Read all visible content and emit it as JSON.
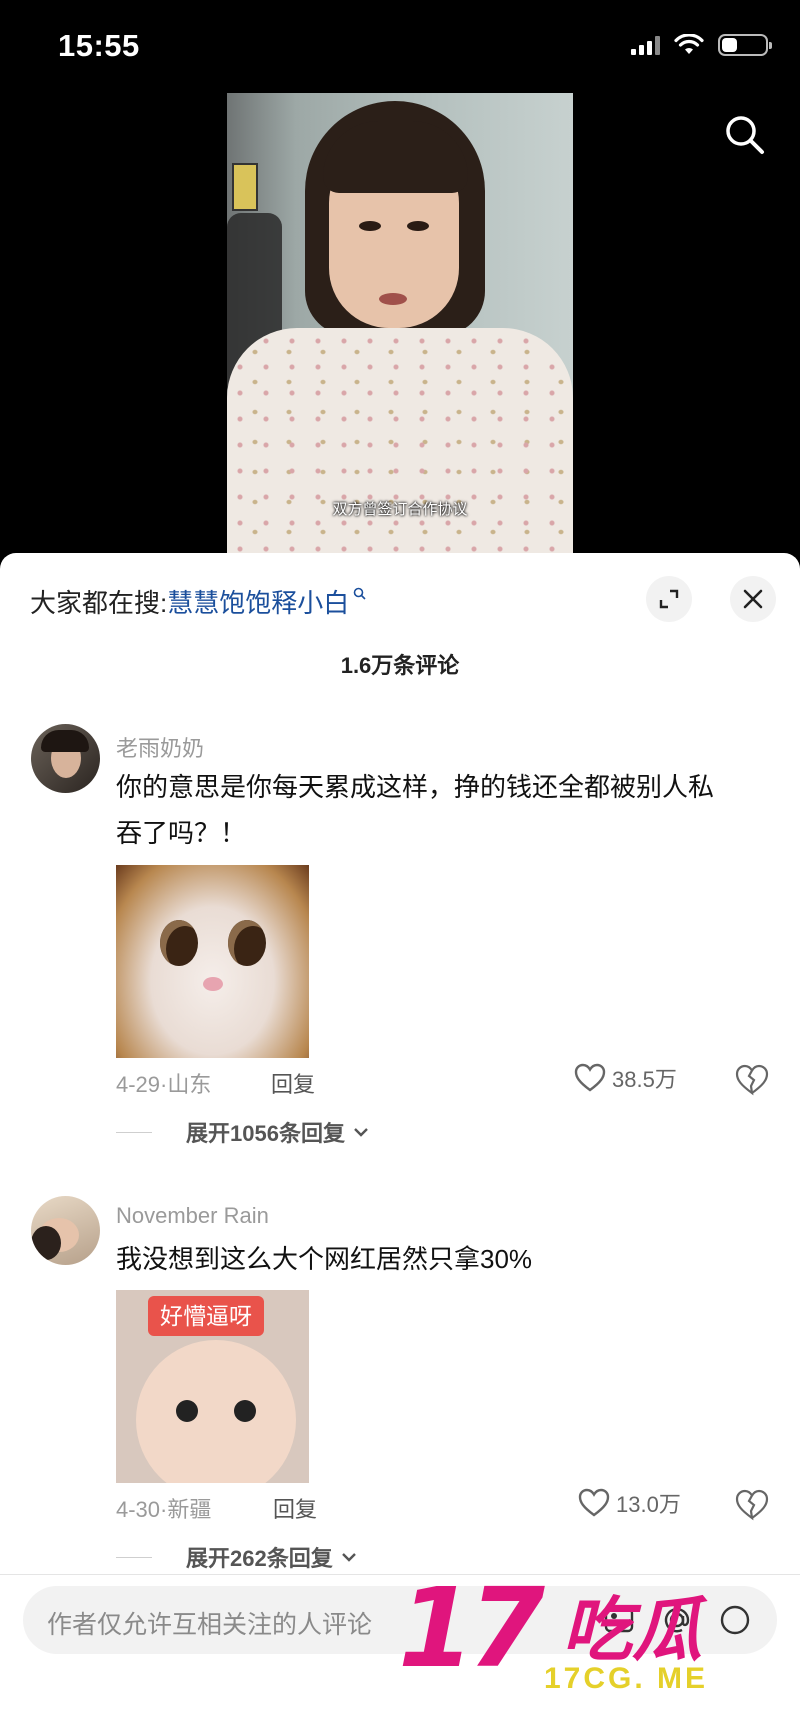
{
  "status_bar": {
    "time": "15:55",
    "battery_level": 0.35
  },
  "video": {
    "subtitle": "双方曾签订合作协议"
  },
  "comments_panel": {
    "hot_search_prefix": "大家都在搜:",
    "hot_search_term": "慧慧饱饱释小白",
    "count_label": "1.6万条评论",
    "comments": [
      {
        "username": "老雨奶奶",
        "text_line1": "你的意思是你每天累成这样，挣的钱还全都被别人私",
        "text_line2": "吞了吗？！",
        "meta": "4-29·山东",
        "reply_label": "回复",
        "likes": "38.5万",
        "expand_label": "展开1056条回复"
      },
      {
        "username": "November Rain",
        "text_line1": "我没想到这么大个网红居然只拿30%",
        "sticker_tag": "好懵逼呀",
        "meta": "4-30·新疆",
        "reply_label": "回复",
        "likes": "13.0万",
        "expand_label": "展开262条回复"
      }
    ]
  },
  "input_bar": {
    "placeholder": "作者仅允许互相关注的人评论"
  },
  "watermark": {
    "big": "17",
    "cn": "吃瓜",
    "site": "17CG. ME"
  },
  "colors": {
    "accent_link": "#1b4f9c",
    "watermark_pink": "#e0157d",
    "watermark_yellow": "#e5d02a"
  }
}
